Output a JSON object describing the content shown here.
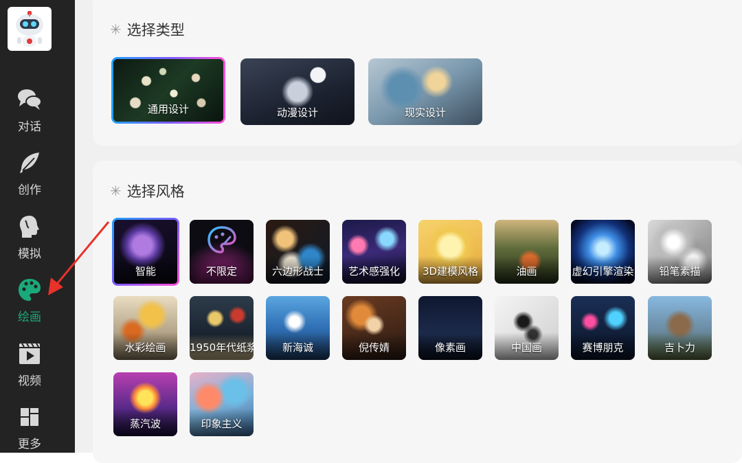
{
  "sidebar": {
    "items": [
      {
        "label": "对话",
        "icon": "chat-bubbles-icon"
      },
      {
        "label": "创作",
        "icon": "feather-icon"
      },
      {
        "label": "模拟",
        "icon": "head-profile-icon"
      },
      {
        "label": "绘画",
        "icon": "palette-icon"
      },
      {
        "label": "视频",
        "icon": "film-play-icon"
      },
      {
        "label": "更多",
        "icon": "grid-more-icon"
      }
    ],
    "active_index": 3,
    "active_color": "#1aa97a"
  },
  "type_section": {
    "title": "选择类型",
    "cards": [
      {
        "label": "通用设计",
        "selected": true
      },
      {
        "label": "动漫设计",
        "selected": false
      },
      {
        "label": "现实设计",
        "selected": false
      }
    ]
  },
  "style_section": {
    "title": "选择风格",
    "cards": [
      {
        "label": "智能",
        "selected": true
      },
      {
        "label": "不限定"
      },
      {
        "label": "六边形战士"
      },
      {
        "label": "艺术感强化"
      },
      {
        "label": "3D建模风格"
      },
      {
        "label": "油画"
      },
      {
        "label": "虚幻引擎渲染"
      },
      {
        "label": "铅笔素描"
      },
      {
        "label": "水彩绘画"
      },
      {
        "label": "1950年代纸浆"
      },
      {
        "label": "新海诚"
      },
      {
        "label": "倪传婧"
      },
      {
        "label": "像素画"
      },
      {
        "label": "中国画"
      },
      {
        "label": "赛博朋克"
      },
      {
        "label": "吉卜力"
      },
      {
        "label": "蒸汽波"
      },
      {
        "label": "印象主义"
      }
    ]
  },
  "annotation_color": "#e8322a"
}
